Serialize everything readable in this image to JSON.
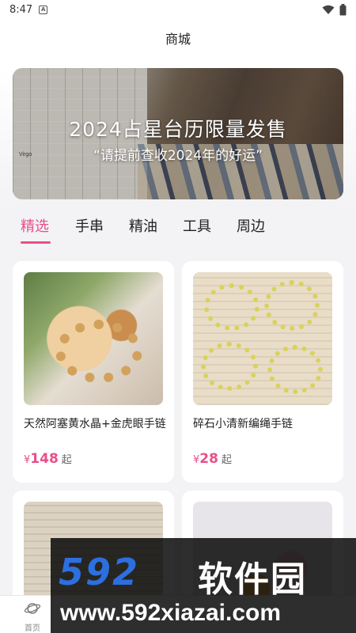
{
  "status_bar": {
    "time": "8:47",
    "notif_glyph": "A"
  },
  "header": {
    "title": "商城"
  },
  "banner": {
    "headline": "2024占星台历限量发售",
    "subline": "“请提前查收2024年的好运”",
    "brand": "Virgo"
  },
  "tabs": [
    {
      "label": "精选",
      "active": true
    },
    {
      "label": "手串",
      "active": false
    },
    {
      "label": "精油",
      "active": false
    },
    {
      "label": "工具",
      "active": false
    },
    {
      "label": "周边",
      "active": false
    }
  ],
  "products": [
    {
      "name": "天然阿塞黄水晶+金虎眼手链",
      "currency": "¥",
      "price": "148",
      "suffix": "起"
    },
    {
      "name": "碎石小清新编绳手链",
      "currency": "¥",
      "price": "28",
      "suffix": "起"
    },
    {
      "name": "",
      "currency": "",
      "price": "",
      "suffix": ""
    },
    {
      "name": "",
      "currency": "",
      "price": "",
      "suffix": ""
    }
  ],
  "bottom_nav": {
    "home_label": "首页",
    "home_icon": "planet-icon"
  },
  "watermark": {
    "logo": "592",
    "brand": "软件园",
    "url": "www.592xiazai.com"
  },
  "colors": {
    "accent": "#e84f8a",
    "background": "#f3f3f6",
    "watermark_blue": "#2c6fe0"
  }
}
